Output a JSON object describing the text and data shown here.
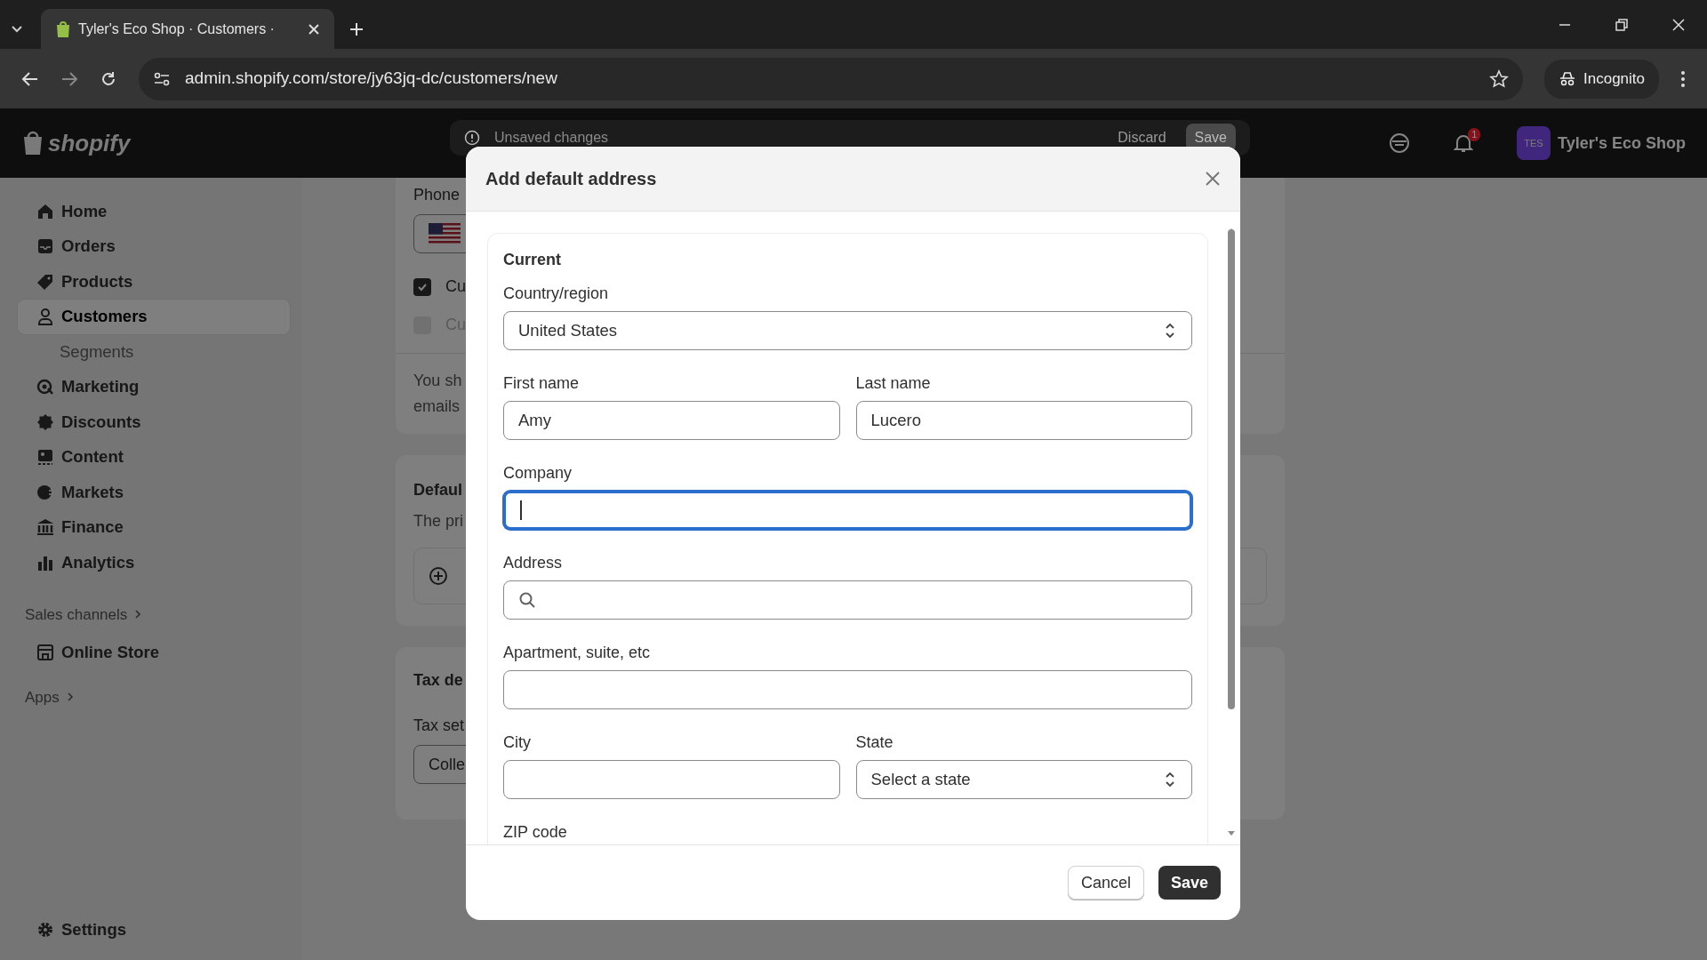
{
  "browser": {
    "tabs": [
      {
        "title": "Tyler's Eco Shop · Customers ·",
        "selected": true
      }
    ],
    "url": "admin.shopify.com/store/jy63jq-dc/customers/new",
    "profile": "Incognito"
  },
  "topbar": {
    "logo": "shopify",
    "notice": "Unsaved changes",
    "actions": [
      {
        "label": "Discard",
        "kind": "plain"
      },
      {
        "label": "Save",
        "kind": "filled"
      }
    ],
    "notification_count": "1",
    "avatar": "TES",
    "store": "Tyler's Eco Shop"
  },
  "sidebar": {
    "sections": [
      {
        "items": [
          {
            "label": "Home",
            "selected": false
          },
          {
            "label": "Orders",
            "selected": false
          },
          {
            "label": "Products",
            "selected": false
          },
          {
            "label": "Customers",
            "selected": true,
            "children": [
              {
                "label": "Segments",
                "selected": false
              }
            ]
          },
          {
            "label": "Marketing",
            "selected": false
          },
          {
            "label": "Discounts",
            "selected": false
          },
          {
            "label": "Content",
            "selected": false
          },
          {
            "label": "Markets",
            "selected": false
          },
          {
            "label": "Finance",
            "selected": false
          },
          {
            "label": "Analytics",
            "selected": false
          }
        ]
      },
      {
        "heading": "Sales channels",
        "items": [
          {
            "label": "Online Store",
            "selected": false
          }
        ]
      },
      {
        "heading": "Apps"
      }
    ],
    "settings": "Settings"
  },
  "page": {
    "phone": {
      "label": "Phone"
    },
    "checkboxes": [
      {
        "label": "Cu",
        "checked": true,
        "disabled": false
      },
      {
        "label": "Cu",
        "checked": false,
        "disabled": true
      }
    ],
    "note_lines": [
      "You sh",
      "emails"
    ],
    "default_address": {
      "title": "Defaul",
      "text": "The pri"
    },
    "tax": {
      "title": "Tax de",
      "label": "Tax set",
      "value": "Colle"
    }
  },
  "modal": {
    "title": "Add default address",
    "section": "Current",
    "rows": [
      [
        {
          "label": "Country/region",
          "kind": "select",
          "value": "United States",
          "focused": false
        }
      ],
      [
        {
          "label": "First name",
          "kind": "text",
          "value": "Amy",
          "focused": false
        },
        {
          "label": "Last name",
          "kind": "text",
          "value": "Lucero",
          "focused": false
        }
      ],
      [
        {
          "label": "Company",
          "kind": "text",
          "focused": true
        }
      ],
      [
        {
          "label": "Address",
          "kind": "search",
          "focused": false
        }
      ],
      [
        {
          "label": "Apartment, suite, etc",
          "kind": "text",
          "focused": false
        }
      ],
      [
        {
          "label": "City",
          "kind": "text",
          "focused": false
        },
        {
          "label": "State",
          "kind": "select",
          "value": "Select a state",
          "focused": false
        }
      ],
      [
        {
          "label": "ZIP code",
          "kind": "cut"
        }
      ]
    ],
    "buttons": [
      {
        "label": "Cancel",
        "kind": "secondary"
      },
      {
        "label": "Save",
        "kind": "primary"
      }
    ]
  }
}
